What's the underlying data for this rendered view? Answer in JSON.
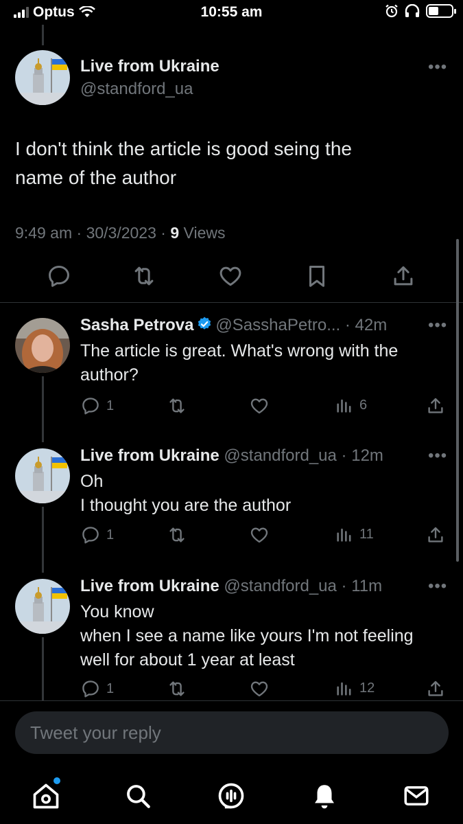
{
  "status_bar": {
    "carrier": "Optus",
    "time": "10:55 am"
  },
  "main_tweet": {
    "name": "Live from Ukraine",
    "handle": "@standford_ua",
    "text_line1": "I don't think the article is good seing the",
    "text_line2": "name of the author",
    "time": "9:49 am",
    "date": "30/3/2023",
    "views_count": "9",
    "views_label": "Views"
  },
  "replies": [
    {
      "name": "Sasha Petrova",
      "handle": "@SasshaPetro...",
      "age": "42m",
      "verified": true,
      "lines": [
        "The article is great. What's wrong with the",
        "author?"
      ],
      "reply_count": "1",
      "views": "6"
    },
    {
      "name": "Live from Ukraine",
      "handle": "@standford_ua",
      "age": "12m",
      "verified": false,
      "lines": [
        "Oh",
        "I thought you are the author"
      ],
      "reply_count": "1",
      "views": "11"
    },
    {
      "name": "Live from Ukraine",
      "handle": "@standford_ua",
      "age": "11m",
      "verified": false,
      "lines": [
        "You know",
        "when I see a name like yours I'm not feeling",
        "well for about 1 year at least"
      ],
      "reply_count": "1",
      "views": "12"
    }
  ],
  "composer": {
    "placeholder": "Tweet your reply"
  },
  "colors": {
    "background": "#000000",
    "primary_text": "#e7e9ea",
    "secondary_text": "#71767b",
    "accent": "#1d9bf0"
  },
  "icons": {
    "reply": "reply-icon",
    "retweet": "retweet-icon",
    "like": "heart-icon",
    "bookmark": "bookmark-icon",
    "share": "share-icon",
    "views": "views-icon",
    "tabs": [
      "home-icon",
      "search-icon",
      "spaces-icon",
      "notifications-icon",
      "messages-icon"
    ]
  }
}
